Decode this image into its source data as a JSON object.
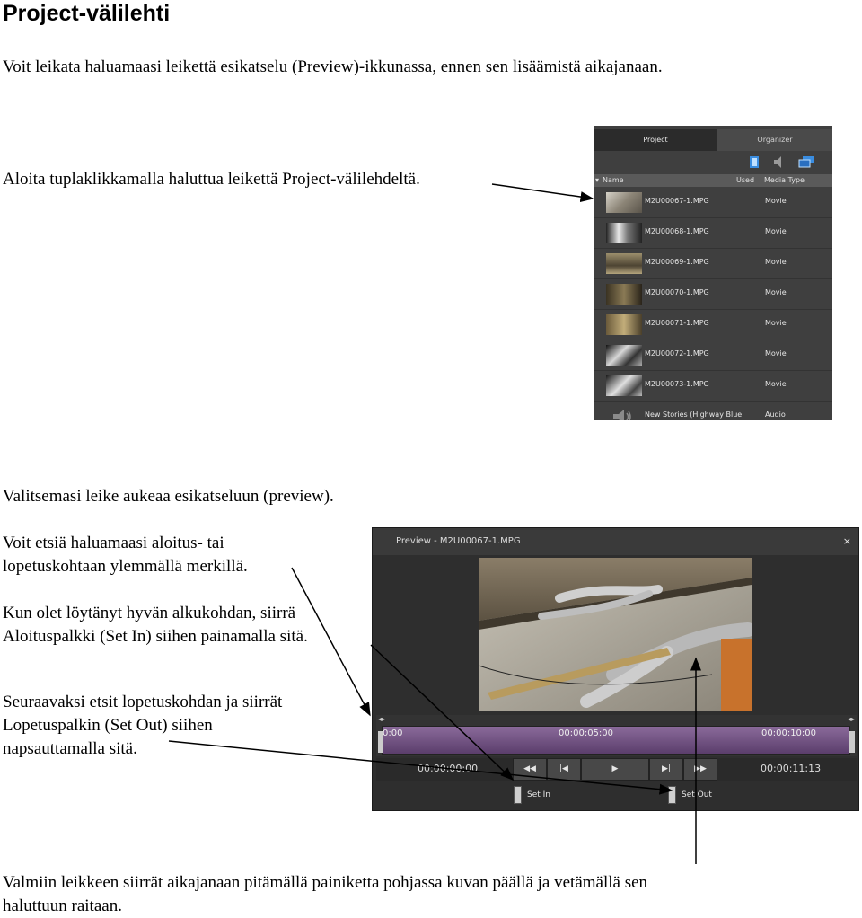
{
  "doc": {
    "title": "Project-välilehti",
    "p1": "Voit leikata haluamaasi leikettä esikatselu (Preview)-ikkunassa, ennen sen lisäämistä aikajanaan.",
    "p2": "Aloita tuplaklikkamalla haluttua leikettä Project-välilehdeltä.",
    "p3": "Valitsemasi leike aukeaa esikatseluun (preview).",
    "p4a": "Voit etsiä haluamaasi aloitus- tai",
    "p4b": "lopetuskohtaan ylemmällä merkillä.",
    "p5a": "Kun olet löytänyt hyvän alkukohdan, siirrä",
    "p5b": "Aloituspalkki (Set In) siihen painamalla sitä.",
    "p6a": "Seuraavaksi etsit lopetuskohdan ja siirrät",
    "p6b": "Lopetuspalkin (Set Out) siihen",
    "p6c": "napsauttamalla sitä.",
    "p7a": "Valmiin leikkeen siirrät aikajanaan pitämällä painiketta pohjassa kuvan päällä ja vetämällä sen",
    "p7b": "haluttuun raitaan."
  },
  "project_panel": {
    "tabs": [
      "Project",
      "Organizer"
    ],
    "columns": {
      "name": "Name",
      "used": "Used",
      "media_type": "Media Type"
    },
    "rows": [
      {
        "name": "M2U00067-1.MPG",
        "type": "Movie"
      },
      {
        "name": "M2U00068-1.MPG",
        "type": "Movie"
      },
      {
        "name": "M2U00069-1.MPG",
        "type": "Movie"
      },
      {
        "name": "M2U00070-1.MPG",
        "type": "Movie"
      },
      {
        "name": "M2U00071-1.MPG",
        "type": "Movie"
      },
      {
        "name": "M2U00072-1.MPG",
        "type": "Movie"
      },
      {
        "name": "M2U00073-1.MPG",
        "type": "Movie"
      },
      {
        "name": "New Stories (Highway Blue",
        "type": "Audio"
      }
    ],
    "icons": [
      "film-icon",
      "speaker-icon",
      "monitors-icon"
    ]
  },
  "preview_panel": {
    "title": "Preview - M2U00067-1.MPG",
    "close": "×",
    "ruler": [
      "0:00",
      "00:00:05:00",
      "00:00:10:00"
    ],
    "current_time": "00:00:00:00",
    "duration": "00:00:11:13",
    "set_in": "Set In",
    "set_out": "Set Out",
    "buttons": [
      "rewind",
      "step-back",
      "play",
      "step-forward",
      "fast-forward"
    ],
    "colors": {
      "timeline": "#6e4f80",
      "panel": "#2e2e2e"
    }
  }
}
